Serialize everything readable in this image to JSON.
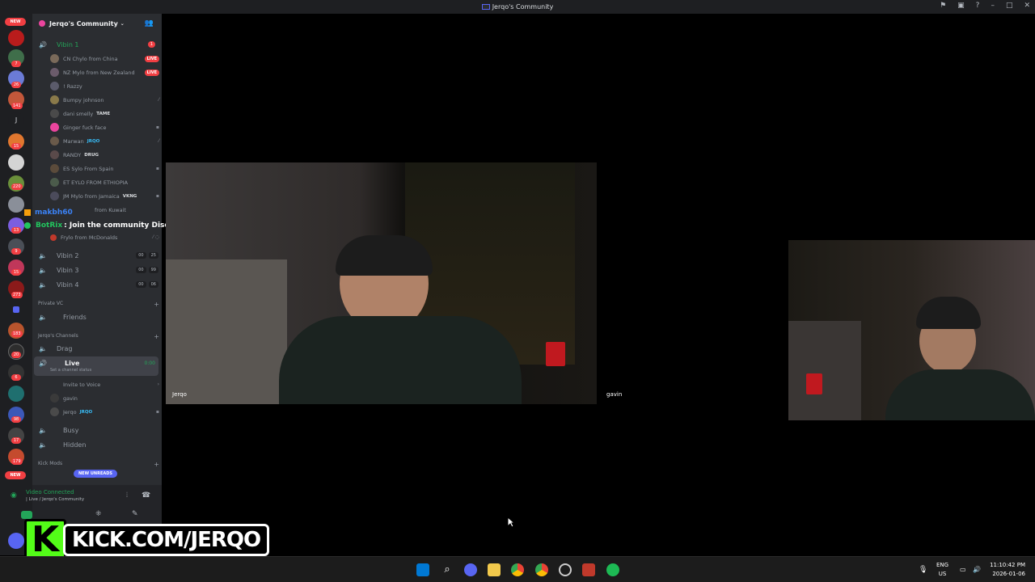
{
  "window": {
    "title": "Jerqo's Community"
  },
  "guild": {
    "name": "Jerqo's Community"
  },
  "server_badges": [
    "NEW",
    "7",
    "26",
    "141",
    "J",
    "15",
    "220",
    "13",
    "9",
    "15",
    "273",
    "183",
    "20",
    "6",
    "98",
    "17",
    "179",
    "NEW"
  ],
  "voice_channels": {
    "vibin1": {
      "label": "Vibin 1",
      "badge": "1"
    },
    "vibin2": {
      "label": "Vibin 2",
      "c1": "00",
      "c2": "25"
    },
    "vibin3": {
      "label": "Vibin 3",
      "c1": "00",
      "c2": "99"
    },
    "vibin4": {
      "label": "Vibin 4",
      "c1": "00",
      "c2": "06"
    }
  },
  "members": [
    {
      "name": "Chylo from China",
      "prefix": "CN",
      "live": "LIVE"
    },
    {
      "name": "Mylo from New Zealand",
      "prefix": "NZ",
      "live": "LIVE"
    },
    {
      "name": "Razzy",
      "prefix": "!"
    },
    {
      "name": "Bumpy johnson"
    },
    {
      "name": "dani smelly",
      "tag": "TAME"
    },
    {
      "name": "Ginger fuck face"
    },
    {
      "name": "Marwan",
      "tag": "JRQO"
    },
    {
      "name": "RANDY",
      "tag": "DRUG"
    },
    {
      "name": "Sylo From Spain",
      "prefix": "ES"
    },
    {
      "name": "EYLO FROM ETHIOPIA",
      "prefix": "ET"
    },
    {
      "name": "Mylo from Jamaica",
      "prefix": "JM",
      "tag": "VKNG"
    },
    {
      "name": "from Kuwait"
    },
    {
      "name": "Frylo from McDonalds"
    }
  ],
  "categories": {
    "private_vc": "Private VC",
    "jerqos_channels": "Jerqo's Channels",
    "kick_mods": "Kick Mods"
  },
  "channels": {
    "friends": "Friends",
    "drag": "Drag",
    "live": "Live",
    "live_time": "0:00",
    "live_status": "Set a channel status",
    "invite": "Invite to Voice",
    "busy": "Busy",
    "hidden": "Hidden"
  },
  "live_members": [
    {
      "name": "gavin"
    },
    {
      "name": "Jerqo",
      "tag": "JRQO"
    }
  ],
  "new_unreads": "NEW UNREADS",
  "voice_status": {
    "title": "Video Connected",
    "subtitle": "| Live / Jerqo's Community"
  },
  "chat": {
    "line1_user": "makbh60",
    "line2_user": "BotRix",
    "line2_msg": ": Join the community Discord https://discord.gg/jerqo"
  },
  "tiles": {
    "left_name": "Jerqo",
    "right_name": "gavin"
  },
  "kick_banner": {
    "letter": "K",
    "text": "KICK.COM/JERQO"
  },
  "taskbar": {
    "lang1": "ENG",
    "lang2": "US",
    "time": "11:10:42 PM",
    "date": "2026-01-06"
  },
  "colors": {
    "discord_green": "#23a559",
    "live_red": "#f23f43",
    "blurple": "#5865f2",
    "kick_green": "#53fc18"
  }
}
